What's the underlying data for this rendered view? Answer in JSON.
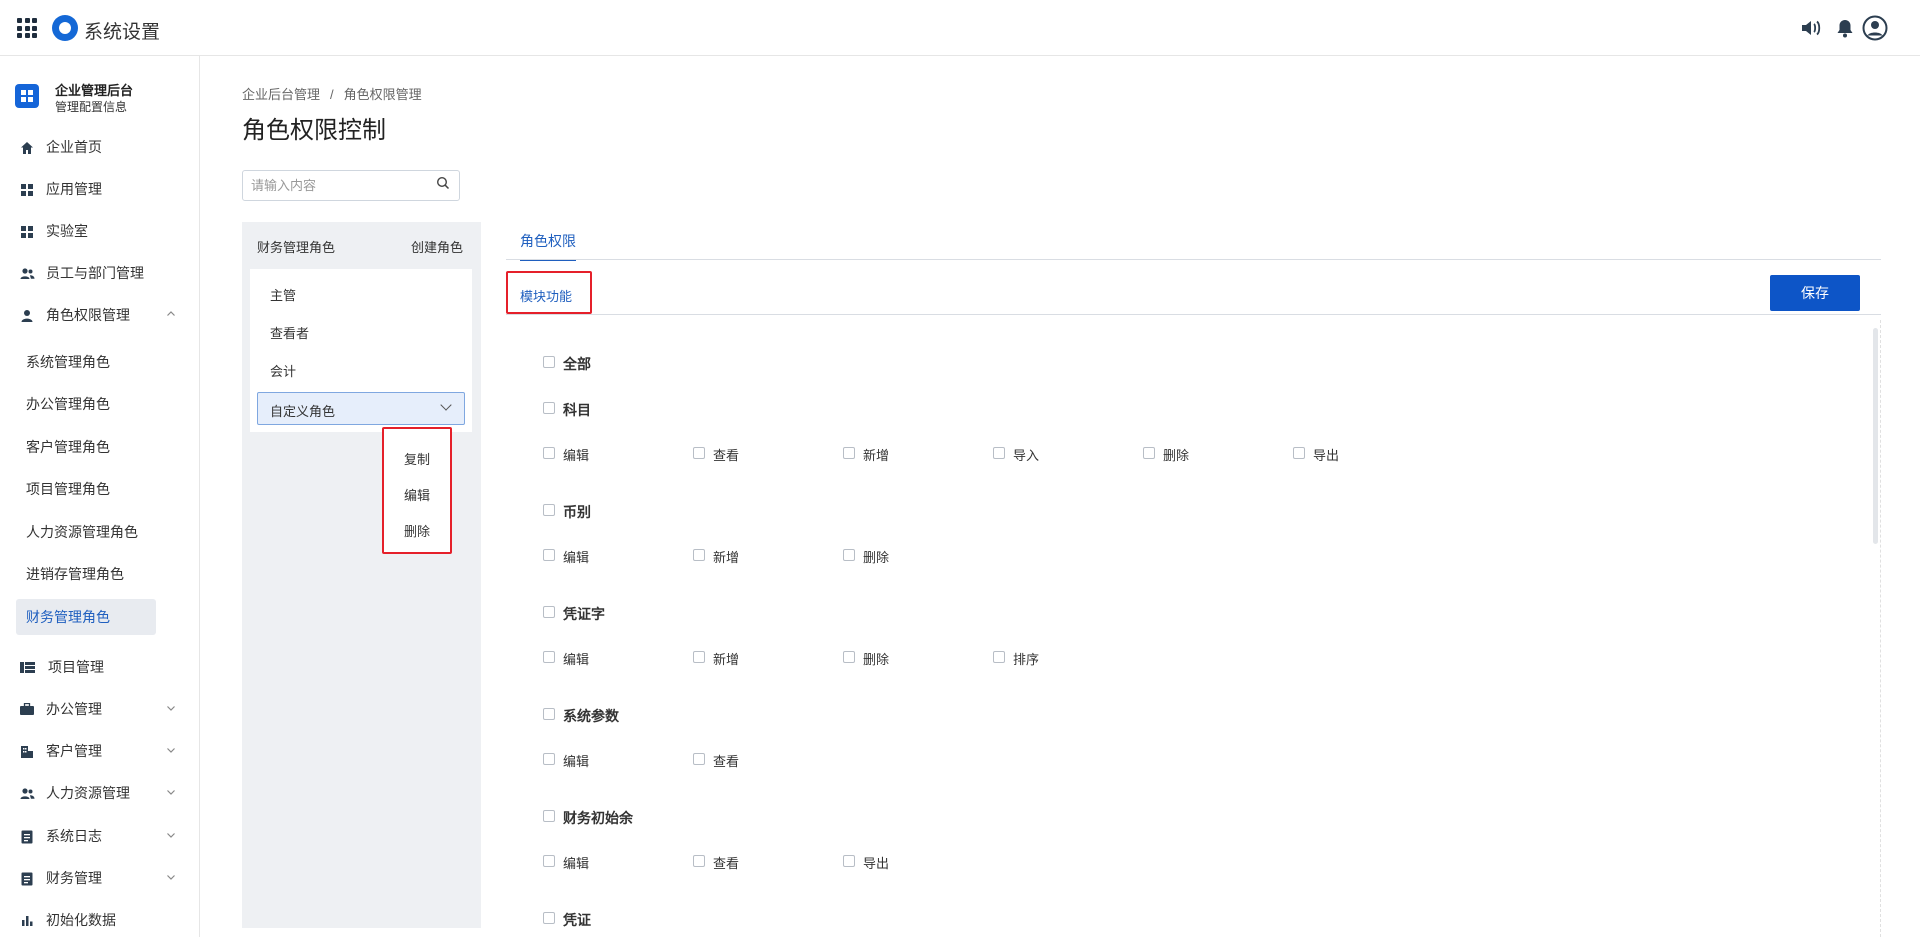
{
  "app": {
    "title": "系统设置"
  },
  "sidebar": {
    "brand_title": "企业管理后台",
    "brand_subtitle": "管理配置信息",
    "items": [
      {
        "label": "企业首页",
        "icon": "home-icon"
      },
      {
        "label": "应用管理",
        "icon": "grid-icon"
      },
      {
        "label": "实验室",
        "icon": "grid-icon"
      },
      {
        "label": "员工与部门管理",
        "icon": "users-icon"
      },
      {
        "label": "角色权限管理",
        "icon": "user-icon",
        "expanded": true
      },
      {
        "label": "项目管理",
        "icon": "list-icon"
      },
      {
        "label": "办公管理",
        "icon": "briefcase-icon"
      },
      {
        "label": "客户管理",
        "icon": "building-icon"
      },
      {
        "label": "人力资源管理",
        "icon": "users-icon"
      },
      {
        "label": "系统日志",
        "icon": "document-icon"
      },
      {
        "label": "财务管理",
        "icon": "document-icon"
      },
      {
        "label": "初始化数据",
        "icon": "bar-chart-icon"
      }
    ],
    "sub_items": [
      {
        "label": "系统管理角色"
      },
      {
        "label": "办公管理角色"
      },
      {
        "label": "客户管理角色"
      },
      {
        "label": "项目管理角色"
      },
      {
        "label": "人力资源管理角色"
      },
      {
        "label": "进销存管理角色"
      },
      {
        "label": "财务管理角色",
        "active": true
      }
    ]
  },
  "breadcrumb": {
    "root": "企业后台管理",
    "separator": "/",
    "current": "角色权限管理"
  },
  "page_title": "角色权限控制",
  "search": {
    "placeholder": "请输入内容",
    "value": ""
  },
  "roles": {
    "header": "财务管理角色",
    "create_label": "创建角色",
    "items": [
      "主管",
      "查看者",
      "会计"
    ],
    "selected": "自定义角色",
    "context_menu": [
      "复制",
      "编辑",
      "删除"
    ]
  },
  "tabs": {
    "role_permission": "角色权限",
    "module_function": "模块功能"
  },
  "save_label": "保存",
  "permissions": {
    "all_label": "全部",
    "groups": [
      {
        "name": "科目",
        "options": [
          "编辑",
          "查看",
          "新增",
          "导入",
          "删除",
          "导出"
        ]
      },
      {
        "name": "币别",
        "options": [
          "编辑",
          "新增",
          "删除"
        ]
      },
      {
        "name": "凭证字",
        "options": [
          "编辑",
          "新增",
          "删除",
          "排序"
        ]
      },
      {
        "name": "系统参数",
        "options": [
          "编辑",
          "查看"
        ]
      },
      {
        "name": "财务初始余",
        "options": [
          "编辑",
          "查看",
          "导出"
        ]
      },
      {
        "name": "凭证",
        "options": []
      }
    ]
  },
  "colors": {
    "accent": "#1f5fbf",
    "primary_button": "#0d55c7",
    "highlight_border": "#e5202a"
  }
}
